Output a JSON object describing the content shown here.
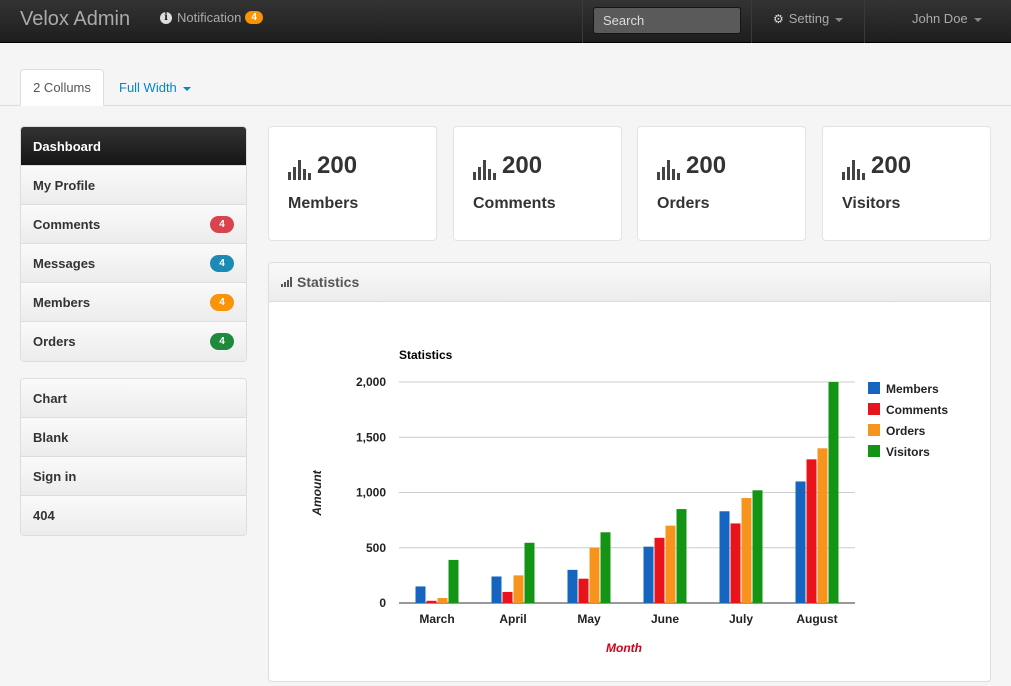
{
  "navbar": {
    "brand": "Velox Admin",
    "notification_label": "Notification",
    "notification_count": "4",
    "search_placeholder": "Search",
    "setting_label": "Setting",
    "user_name": "John Doe"
  },
  "tabs": {
    "active": "2 Collums",
    "other": "Full Width"
  },
  "sidebar": {
    "primary": [
      {
        "label": "Dashboard",
        "active": true
      },
      {
        "label": "My Profile"
      },
      {
        "label": "Comments",
        "badge": "4",
        "badge_color": "#d9434e"
      },
      {
        "label": "Messages",
        "badge": "4",
        "badge_color": "#1b8ab5"
      },
      {
        "label": "Members",
        "badge": "4",
        "badge_color": "#f89406"
      },
      {
        "label": "Orders",
        "badge": "4",
        "badge_color": "#1e8a3c"
      }
    ],
    "secondary": [
      {
        "label": "Chart"
      },
      {
        "label": "Blank"
      },
      {
        "label": "Sign in"
      },
      {
        "label": "404"
      }
    ]
  },
  "stats": [
    {
      "value": "200",
      "label": "Members"
    },
    {
      "value": "200",
      "label": "Comments"
    },
    {
      "value": "200",
      "label": "Orders"
    },
    {
      "value": "200",
      "label": "Visitors"
    }
  ],
  "panel": {
    "title": "Statistics"
  },
  "chart_data": {
    "type": "bar",
    "title": "Statistics",
    "xlabel": "Month",
    "ylabel": "Amount",
    "ylim": [
      0,
      2000
    ],
    "yticks": [
      "0",
      "500",
      "1,000",
      "1,500",
      "2,000"
    ],
    "categories": [
      "March",
      "April",
      "May",
      "June",
      "July",
      "August"
    ],
    "legend_position": "right",
    "series": [
      {
        "name": "Members",
        "color": "#1565c0",
        "values": [
          150,
          240,
          300,
          510,
          830,
          1100
        ]
      },
      {
        "name": "Comments",
        "color": "#e8141c",
        "values": [
          20,
          100,
          220,
          590,
          720,
          1300
        ]
      },
      {
        "name": "Orders",
        "color": "#f7941d",
        "values": [
          45,
          250,
          500,
          700,
          950,
          1400
        ]
      },
      {
        "name": "Visitors",
        "color": "#149414",
        "values": [
          390,
          545,
          640,
          850,
          1020,
          2000
        ]
      }
    ]
  }
}
